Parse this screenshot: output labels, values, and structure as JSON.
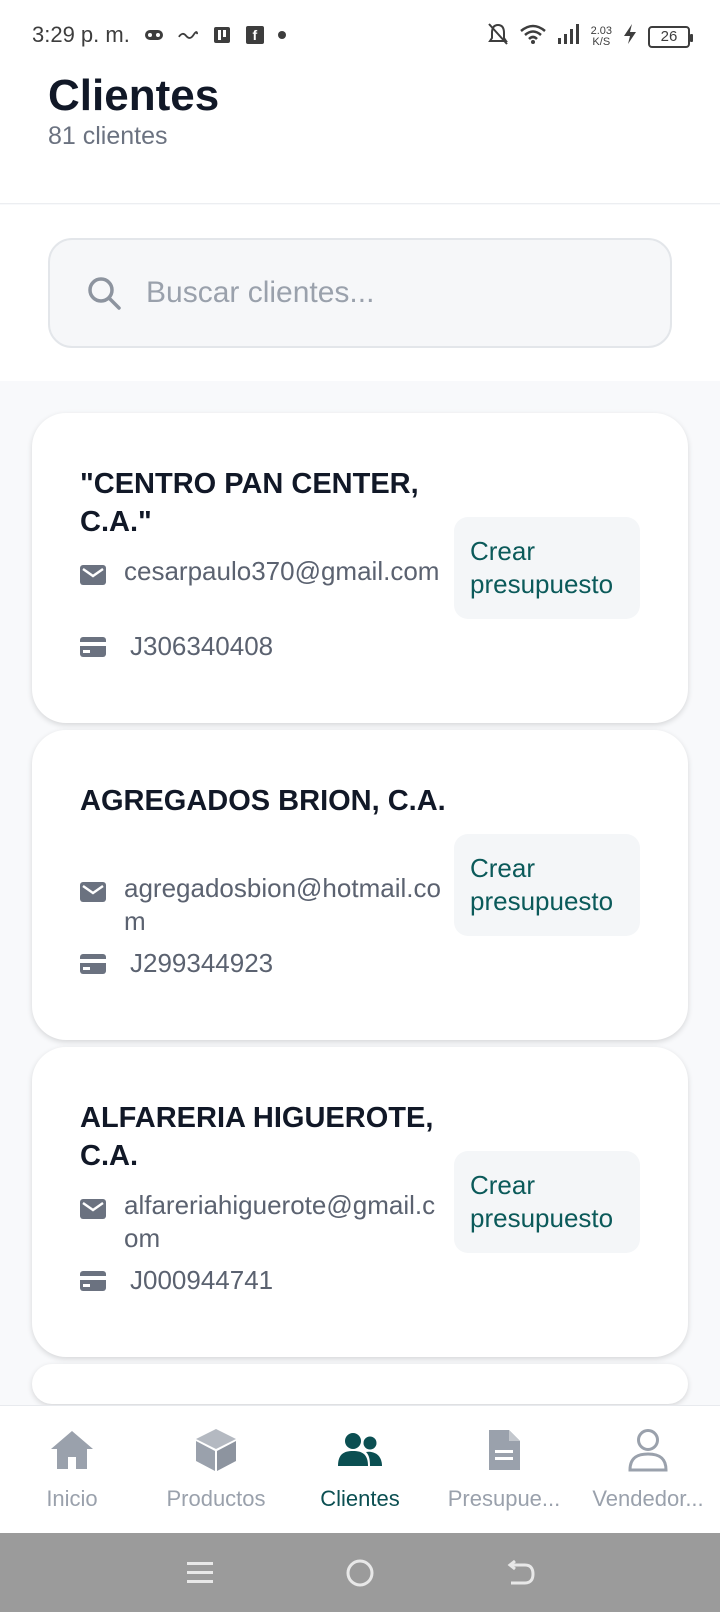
{
  "status_bar": {
    "time": "3:29 p. m.",
    "speed_value": "2.03",
    "speed_unit": "K/S",
    "battery": "26"
  },
  "header": {
    "title": "Clientes",
    "subtitle": "81 clientes"
  },
  "search": {
    "placeholder": "Buscar clientes...",
    "value": ""
  },
  "clients": [
    {
      "name": "\"CENTRO PAN CENTER, C.A.\"",
      "email": "cesarpaulo370@gmail.com",
      "id": "J306340408",
      "button": "Crear presupuesto"
    },
    {
      "name": "AGREGADOS BRION, C.A.",
      "email": "agregadosbion@hotmail.com",
      "id": "J299344923",
      "button": "Crear presupuesto"
    },
    {
      "name": "ALFARERIA HIGUEROTE, C.A.",
      "email": "alfareriahiguerote@gmail.com",
      "id": "J000944741",
      "button": "Crear presupuesto"
    }
  ],
  "nav": {
    "items": [
      {
        "label": "Inicio",
        "icon": "home-icon"
      },
      {
        "label": "Productos",
        "icon": "box-icon"
      },
      {
        "label": "Clientes",
        "icon": "users-icon"
      },
      {
        "label": "Presupue...",
        "icon": "document-icon"
      },
      {
        "label": "Vendedor...",
        "icon": "person-icon"
      }
    ],
    "active": "Clientes"
  },
  "colors": {
    "accent": "#0b4f52",
    "button_text": "#0b5a5a",
    "inactive": "#9aa1ac",
    "background": "#f8f9fb"
  }
}
